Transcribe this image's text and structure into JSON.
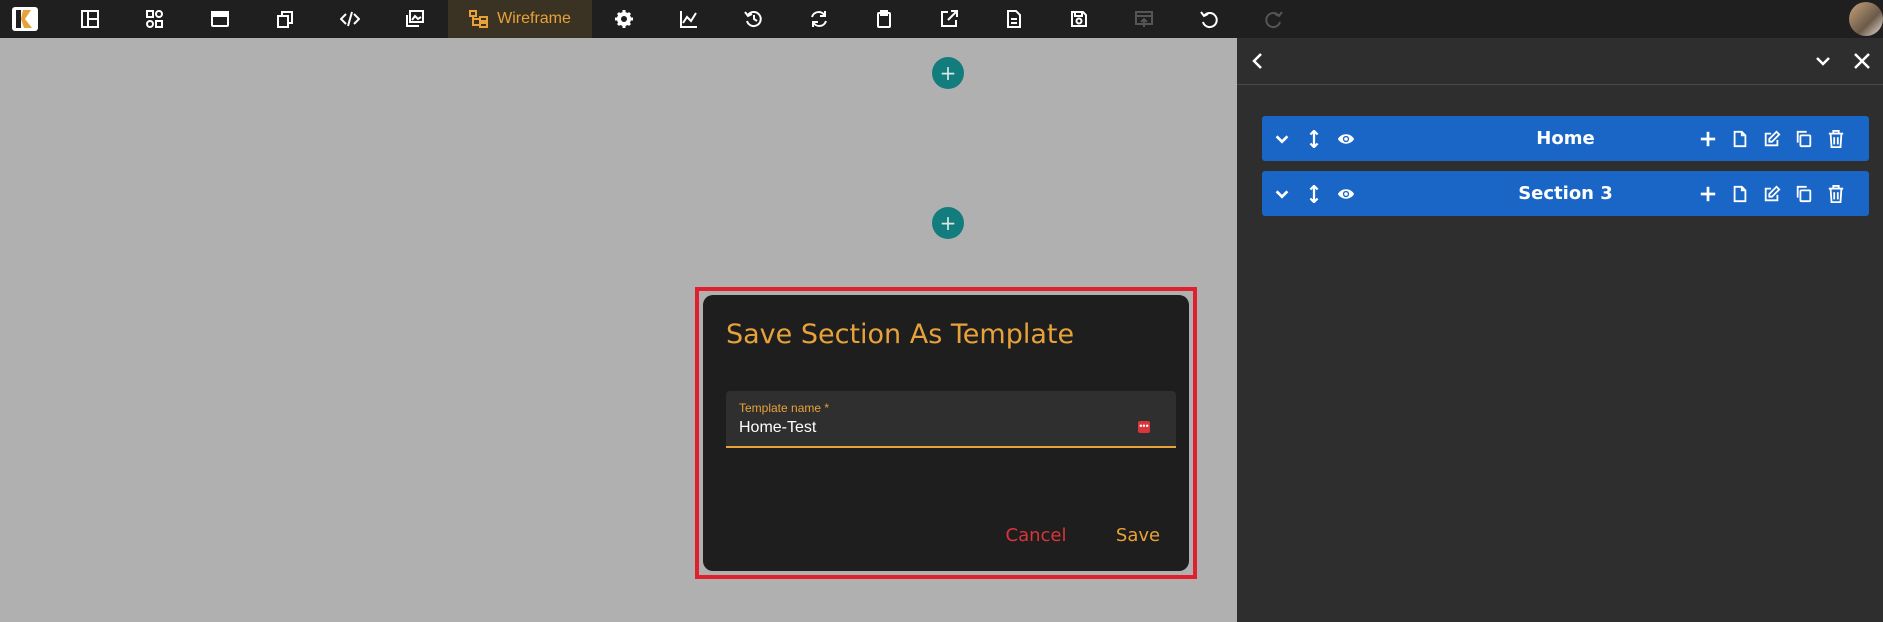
{
  "toolbar": {
    "wireframe_label": "Wireframe",
    "icons": [
      "layout-icon",
      "widgets-icon",
      "window-icon",
      "pages-icon",
      "code-icon",
      "gallery-icon",
      "settings-icon",
      "analytics-icon",
      "history-icon",
      "sync-icon",
      "clipboard-icon",
      "external-link-icon",
      "document-icon",
      "save-icon",
      "publish-icon",
      "undo-icon",
      "redo-icon"
    ]
  },
  "panel": {
    "sections": [
      {
        "title": "Home"
      },
      {
        "title": "Section 3"
      }
    ]
  },
  "modal": {
    "title": "Save Section As Template",
    "field_label": "Template name",
    "field_required": "*",
    "field_value": "Home-Test",
    "cancel_label": "Cancel",
    "save_label": "Save"
  },
  "colors": {
    "accent": "#e8a23a",
    "section_blue": "#1966c6",
    "danger": "#d9353b",
    "teal": "#137c7c"
  }
}
